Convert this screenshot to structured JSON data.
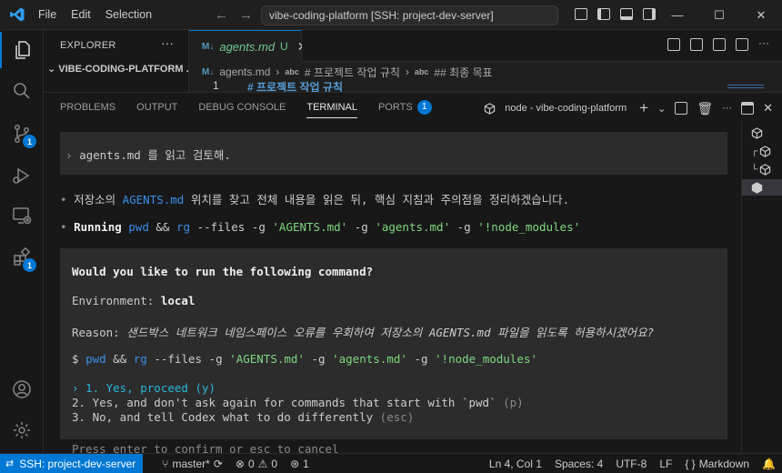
{
  "titlebar": {
    "menu": [
      "File",
      "Edit",
      "Selection"
    ],
    "command_center": "vibe-coding-platform [SSH: project-dev-server]",
    "win_controls": {
      "minimize": "—",
      "maximize": "☐",
      "close": "✕"
    }
  },
  "activity": {
    "scm_badge": "1",
    "extensions_badge": "1"
  },
  "sidebar": {
    "title": "EXPLORER",
    "more": "···",
    "folder": "VIBE-CODING-PLATFORM ..."
  },
  "editor": {
    "tab": {
      "icon": "M↓",
      "name": "agents.md",
      "status": "U",
      "close": "✕"
    },
    "breadcrumbs": {
      "file": "agents.md",
      "h1": "# 프로젝트 작업 규칙",
      "h2": "## 최종 목표"
    },
    "line_number": "1",
    "line_text": "# 프로젝트 작업 규칙"
  },
  "panel": {
    "tabs": [
      "PROBLEMS",
      "OUTPUT",
      "DEBUG CONSOLE",
      "TERMINAL",
      "PORTS"
    ],
    "active_tab": "TERMINAL",
    "ports_badge": "1",
    "terminal_name": "node - vibe-coding-platform",
    "actions": {
      "add": "+",
      "split_more": "⌄",
      "more": "···",
      "close": "✕"
    }
  },
  "terminal": {
    "prompt_marker": "›",
    "prompt": "agents.md 를 읽고 검토해.",
    "bullet": "•",
    "msg_pre": "저장소의 ",
    "msg_file": "AGENTS.md",
    "msg_post": " 위치를 찾고 전체 내용을 읽은 뒤, 핵심 지침과 주의점을 정리하겠습니다.",
    "running_label": "Running",
    "cmd": {
      "pwd": "pwd",
      "and": "&&",
      "rg": "rg",
      "flag_files": "--files",
      "g": "-g",
      "arg1": "'AGENTS.md'",
      "arg2": "'agents.md'",
      "arg3": "'!node_modules'"
    },
    "approval": {
      "question": "Would you like to run the following command?",
      "env_label": "Environment:",
      "env_value": "local",
      "reason_label": "Reason:",
      "reason_value": "샌드박스 네트워크 네임스페이스 오류를 우회하여 저장소의 AGENTS.md 파일을 읽도록 허용하시겠어요?",
      "dollar": "$",
      "option1": "› 1. Yes, proceed (y)",
      "option2": "2. Yes, and don't ask again for commands that start with `pwd`",
      "option2_key": "(p)",
      "option3": "3. No, and tell Codex what to do differently",
      "option3_key": "(esc)"
    },
    "hint": "Press enter to confirm or esc to cancel"
  },
  "statusbar": {
    "remote": "SSH: project-dev-server",
    "branch": "master*",
    "errors": "0",
    "warnings": "0",
    "ports": "1",
    "position": "Ln 4, Col 1",
    "spaces": "Spaces: 4",
    "encoding": "UTF-8",
    "eol": "LF",
    "braces": "{ }",
    "language": "Markdown"
  },
  "colors": {
    "accent": "#0078d4",
    "untracked": "#73c991",
    "terminal_blue": "#3b8eea",
    "terminal_green": "#7fd87f",
    "terminal_cyan": "#29b8db"
  }
}
